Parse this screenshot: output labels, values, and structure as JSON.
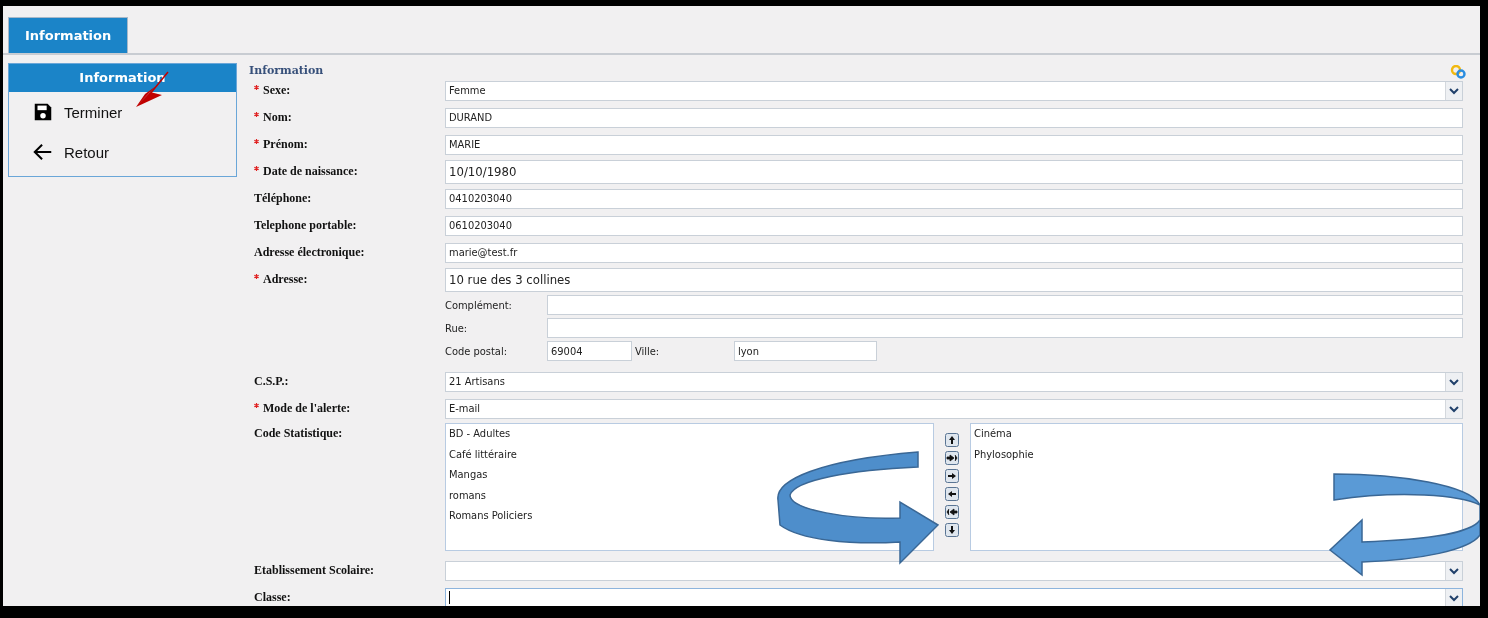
{
  "tabs": [
    {
      "label": "Information",
      "selected": true
    }
  ],
  "side_panel": {
    "title": "Information",
    "items": [
      {
        "label": "Terminer",
        "kind": "save"
      },
      {
        "label": "Retour",
        "kind": "back"
      }
    ]
  },
  "form": {
    "title": "Information",
    "fields": [
      {
        "kind": "select",
        "label": "Sexe:",
        "required": true,
        "value": "Femme",
        "focused": false
      },
      {
        "kind": "text",
        "label": "Nom:",
        "required": true,
        "value": "DURAND"
      },
      {
        "kind": "text",
        "label": "Prénom:",
        "required": true,
        "value": "MARIE"
      },
      {
        "kind": "text",
        "label": "Date de naissance:",
        "required": true,
        "value": "10/10/1980",
        "large": true
      },
      {
        "kind": "text",
        "label": "Téléphone:",
        "required": false,
        "value": "0410203040"
      },
      {
        "kind": "text",
        "label": "Telephone portable:",
        "required": false,
        "value": "0610203040"
      },
      {
        "kind": "text",
        "label": "Adresse électronique:",
        "required": false,
        "value": "marie@test.fr"
      },
      {
        "kind": "text",
        "label": "Adresse:",
        "required": true,
        "value": "10 rue des 3 collines",
        "large": true
      },
      {
        "kind": "address_detail",
        "lines": [
          {
            "label": "Complément:"
          },
          {
            "label": "Rue:"
          }
        ],
        "postal": {
          "label": "Code postal:",
          "value": "69004"
        },
        "city": {
          "label": "Ville:",
          "value": "lyon"
        }
      },
      {
        "kind": "select",
        "label": "C.S.P.:",
        "required": false,
        "value": "21 Artisans",
        "focused": false
      },
      {
        "kind": "select",
        "label": "Mode de l'alerte:",
        "required": true,
        "value": "E-mail",
        "focused": false
      },
      {
        "kind": "dual_list",
        "label": "Code Statistique:",
        "required": false,
        "available": [
          "BD - Adultes",
          "Café littéraire",
          "Mangas",
          "romans",
          "Romans Policiers"
        ],
        "chosen": [
          "Cinéma",
          "Phylosophie"
        ]
      },
      {
        "kind": "select",
        "label": "Etablissement Scolaire:",
        "required": false,
        "focused": false
      },
      {
        "kind": "select",
        "label": "Classe:",
        "required": false,
        "focused": true
      }
    ]
  }
}
